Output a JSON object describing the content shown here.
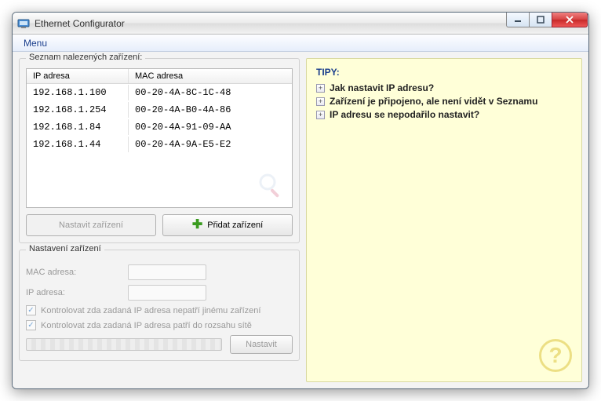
{
  "window": {
    "title": "Ethernet Configurator"
  },
  "menu": {
    "label": "Menu"
  },
  "groups": {
    "device_list_label": "Seznam nalezených zařízení:",
    "settings_label": "Nastavení zařízení"
  },
  "columns": {
    "ip": "IP adresa",
    "mac": "MAC adresa"
  },
  "devices": [
    {
      "ip": "192.168.1.100",
      "mac": "00-20-4A-8C-1C-48"
    },
    {
      "ip": "192.168.1.254",
      "mac": "00-20-4A-B0-4A-86"
    },
    {
      "ip": "192.168.1.84",
      "mac": "00-20-4A-91-09-AA"
    },
    {
      "ip": "192.168.1.44",
      "mac": "00-20-4A-9A-E5-E2"
    }
  ],
  "buttons": {
    "configure": "Nastavit zařízení",
    "add": "Přidat zařízení",
    "set": "Nastavit"
  },
  "form": {
    "mac_label": "MAC adresa:",
    "ip_label": "IP adresa:",
    "mac_value": "",
    "ip_value": "",
    "check1": "Kontrolovat zda zadaná IP adresa nepatří jinému zařízení",
    "check2": "Kontrolovat zda zadaná IP adresa patří do rozsahu sítě"
  },
  "tips": {
    "title": "TIPY:",
    "items": [
      "Jak nastavit IP adresu?",
      "Zařízení je připojeno, ale není vidět v Seznamu",
      "IP adresu se nepodařilo nastavit?"
    ]
  }
}
